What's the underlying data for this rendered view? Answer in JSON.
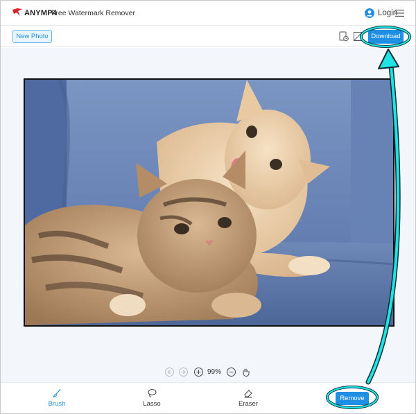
{
  "header": {
    "brand": "ANYMP4",
    "product": "Free Watermark Remover",
    "login_label": "Login"
  },
  "toolbar": {
    "new_photo_label": "New Photo",
    "download_label": "Download"
  },
  "canvas": {
    "zoom_level": "99%"
  },
  "tools": {
    "brush_label": "Brush",
    "lasso_label": "Lasso",
    "eraser_label": "Eraser",
    "remove_label": "Remove",
    "active": "Brush"
  },
  "colors": {
    "accent": "#1f8fe6",
    "annotation": "#1fe3e3",
    "sofa": "#5f7db2"
  },
  "icons": [
    "logo-icon",
    "user-icon",
    "menu-icon",
    "history-icon",
    "compare-icon",
    "undo-icon",
    "redo-icon",
    "zoom-in-icon",
    "zoom-out-icon",
    "hand-icon",
    "brush-icon",
    "lasso-icon",
    "eraser-icon"
  ]
}
